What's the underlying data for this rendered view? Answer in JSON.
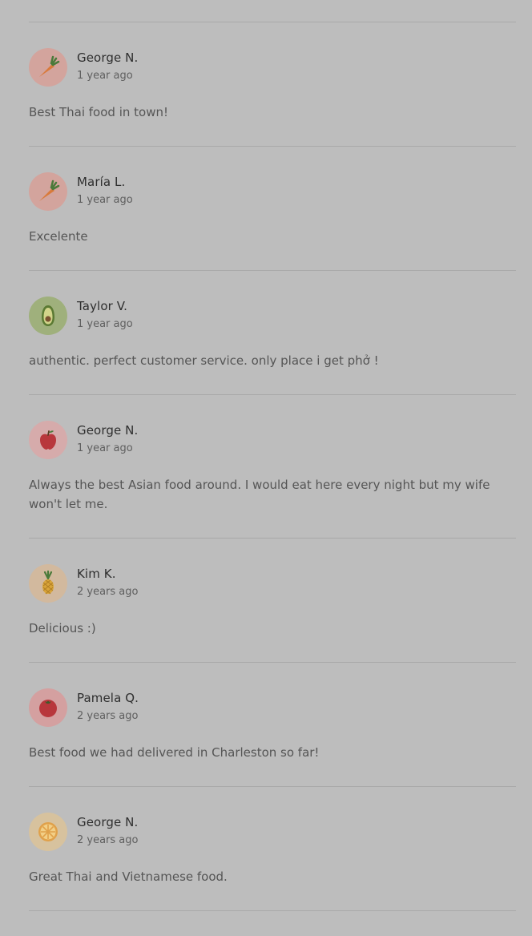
{
  "reviews": [
    {
      "name": "George N.",
      "time": "1 year ago",
      "text": "Best Thai food in town!",
      "avatar_icon": "carrot-icon",
      "avatar_bg": "#d3a49d"
    },
    {
      "name": "María L.",
      "time": "1 year ago",
      "text": "Excelente",
      "avatar_icon": "carrot-icon",
      "avatar_bg": "#d3a49d"
    },
    {
      "name": "Taylor V.",
      "time": "1 year ago",
      "text": "authentic. perfect customer service. only place i get phở !",
      "avatar_icon": "avocado-icon",
      "avatar_bg": "#9fb07c"
    },
    {
      "name": "George N.",
      "time": "1 year ago",
      "text": "Always the best Asian food around. I would eat here every night but my wife won't let me.",
      "avatar_icon": "apple-icon",
      "avatar_bg": "#d6abab"
    },
    {
      "name": "Kim K.",
      "time": "2 years ago",
      "text": "Delicious :)",
      "avatar_icon": "pineapple-icon",
      "avatar_bg": "#d2b99e"
    },
    {
      "name": "Pamela Q.",
      "time": "2 years ago",
      "text": "Best food we had delivered in Charleston so far!",
      "avatar_icon": "tomato-icon",
      "avatar_bg": "#d4a0a0"
    },
    {
      "name": "George N.",
      "time": "2 years ago",
      "text": "Great Thai and Vietnamese food.",
      "avatar_icon": "orange-slice-icon",
      "avatar_bg": "#d7c29e"
    }
  ]
}
